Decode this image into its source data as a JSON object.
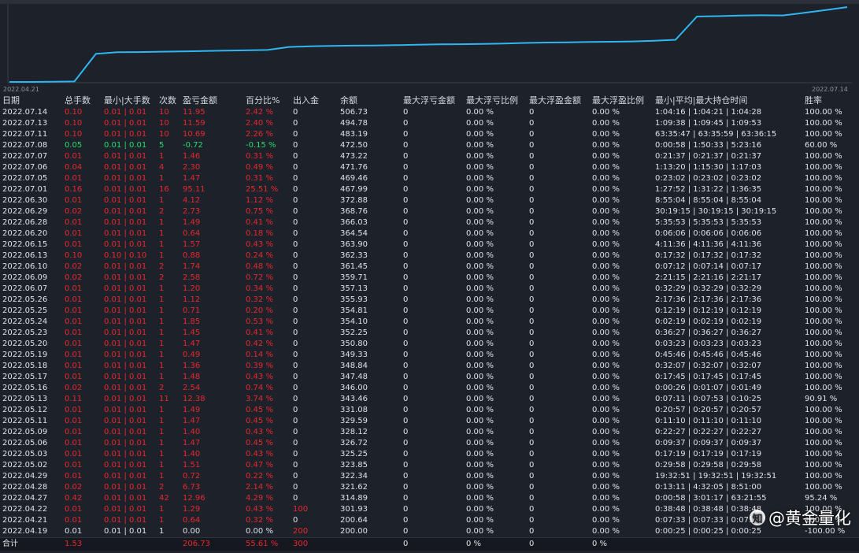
{
  "chart_data": {
    "type": "line",
    "x_start_label": "2022.04.21",
    "x_end_label": "2022.07.14",
    "line_color": "#2fb6f0",
    "series": [
      {
        "values": [
          200.0,
          200.64,
          201.93,
          314.89,
          321.62,
          322.34,
          323.85,
          325.25,
          326.72,
          328.12,
          329.59,
          331.08,
          343.46,
          346.0,
          347.48,
          348.84,
          349.33,
          350.8,
          352.25,
          354.1,
          354.81,
          355.93,
          357.13,
          359.71,
          361.45,
          362.33,
          363.9,
          364.54,
          366.03,
          368.76,
          372.88,
          467.99,
          469.46,
          471.76,
          473.22,
          472.5,
          483.19,
          494.78,
          506.73
        ]
      }
    ]
  },
  "table": {
    "headers": [
      "日期",
      "总手数",
      "最小|大手数",
      "次数",
      "盈亏金额",
      "百分比%",
      "出入金",
      "余额",
      "最大浮亏金额",
      "最大浮亏比例",
      "最大浮盈金额",
      "最大浮盈比例",
      "最小|平均|最大持仓时间",
      "胜率"
    ],
    "rows": [
      {
        "date": "2022.07.14",
        "lots": "0.10",
        "minmax": "0.01 | 0.01",
        "count": "10",
        "pnl": "11.95",
        "pct": "2.42 %",
        "flow": "0",
        "balance": "506.73",
        "fl_amt": "0",
        "fl_pct": "0.00 %",
        "fp_amt": "0",
        "fp_pct": "0.00 %",
        "hold": "1:04:16 | 1:04:21 | 1:04:28",
        "win": "100.00 %",
        "color": "red"
      },
      {
        "date": "2022.07.13",
        "lots": "0.10",
        "minmax": "0.01 | 0.01",
        "count": "10",
        "pnl": "11.59",
        "pct": "2.40 %",
        "flow": "0",
        "balance": "494.78",
        "fl_amt": "0",
        "fl_pct": "0.00 %",
        "fp_amt": "0",
        "fp_pct": "0.00 %",
        "hold": "1:09:38 | 1:09:45 | 1:09:53",
        "win": "100.00 %",
        "color": "red"
      },
      {
        "date": "2022.07.11",
        "lots": "0.10",
        "minmax": "0.01 | 0.01",
        "count": "10",
        "pnl": "10.69",
        "pct": "2.26 %",
        "flow": "0",
        "balance": "483.19",
        "fl_amt": "0",
        "fl_pct": "0.00 %",
        "fp_amt": "0",
        "fp_pct": "0.00 %",
        "hold": "63:35:47 | 63:35:59 | 63:36:15",
        "win": "100.00 %",
        "color": "red"
      },
      {
        "date": "2022.07.08",
        "lots": "0.05",
        "minmax": "0.01 | 0.01",
        "count": "5",
        "pnl": "-0.72",
        "pct": "-0.15 %",
        "flow": "0",
        "balance": "472.50",
        "fl_amt": "0",
        "fl_pct": "0.00 %",
        "fp_amt": "0",
        "fp_pct": "0.00 %",
        "hold": "0:00:58 | 1:50:33 | 5:23:16",
        "win": "60.00 %",
        "color": "green"
      },
      {
        "date": "2022.07.07",
        "lots": "0.01",
        "minmax": "0.01 | 0.01",
        "count": "1",
        "pnl": "1.46",
        "pct": "0.31 %",
        "flow": "0",
        "balance": "473.22",
        "fl_amt": "0",
        "fl_pct": "0.00 %",
        "fp_amt": "0",
        "fp_pct": "0.00 %",
        "hold": "0:21:37 | 0:21:37 | 0:21:37",
        "win": "100.00 %",
        "color": "red"
      },
      {
        "date": "2022.07.06",
        "lots": "0.04",
        "minmax": "0.01 | 0.01",
        "count": "4",
        "pnl": "2.30",
        "pct": "0.49 %",
        "flow": "0",
        "balance": "471.76",
        "fl_amt": "0",
        "fl_pct": "0.00 %",
        "fp_amt": "0",
        "fp_pct": "0.00 %",
        "hold": "1:13:20 | 1:15:30 | 1:17:03",
        "win": "100.00 %",
        "color": "red"
      },
      {
        "date": "2022.07.05",
        "lots": "0.01",
        "minmax": "0.01 | 0.01",
        "count": "1",
        "pnl": "1.47",
        "pct": "0.31 %",
        "flow": "0",
        "balance": "469.46",
        "fl_amt": "0",
        "fl_pct": "0.00 %",
        "fp_amt": "0",
        "fp_pct": "0.00 %",
        "hold": "0:23:02 | 0:23:02 | 0:23:02",
        "win": "100.00 %",
        "color": "red"
      },
      {
        "date": "2022.07.01",
        "lots": "0.16",
        "minmax": "0.01 | 0.01",
        "count": "16",
        "pnl": "95.11",
        "pct": "25.51 %",
        "flow": "0",
        "balance": "467.99",
        "fl_amt": "0",
        "fl_pct": "0.00 %",
        "fp_amt": "0",
        "fp_pct": "0.00 %",
        "hold": "1:27:52 | 1:31:22 | 1:36:35",
        "win": "100.00 %",
        "color": "red"
      },
      {
        "date": "2022.06.30",
        "lots": "0.01",
        "minmax": "0.01 | 0.01",
        "count": "1",
        "pnl": "4.12",
        "pct": "1.12 %",
        "flow": "0",
        "balance": "372.88",
        "fl_amt": "0",
        "fl_pct": "0.00 %",
        "fp_amt": "0",
        "fp_pct": "0.00 %",
        "hold": "8:55:04 | 8:55:04 | 8:55:04",
        "win": "100.00 %",
        "color": "red"
      },
      {
        "date": "2022.06.29",
        "lots": "0.02",
        "minmax": "0.01 | 0.01",
        "count": "2",
        "pnl": "2.73",
        "pct": "0.75 %",
        "flow": "0",
        "balance": "368.76",
        "fl_amt": "0",
        "fl_pct": "0.00 %",
        "fp_amt": "0",
        "fp_pct": "0.00 %",
        "hold": "30:19:15 | 30:19:15 | 30:19:15",
        "win": "100.00 %",
        "color": "red"
      },
      {
        "date": "2022.06.28",
        "lots": "0.01",
        "minmax": "0.01 | 0.01",
        "count": "1",
        "pnl": "1.49",
        "pct": "0.41 %",
        "flow": "0",
        "balance": "366.03",
        "fl_amt": "0",
        "fl_pct": "0.00 %",
        "fp_amt": "0",
        "fp_pct": "0.00 %",
        "hold": "5:35:53 | 5:35:53 | 5:35:53",
        "win": "100.00 %",
        "color": "red"
      },
      {
        "date": "2022.06.20",
        "lots": "0.01",
        "minmax": "0.01 | 0.01",
        "count": "1",
        "pnl": "0.64",
        "pct": "0.18 %",
        "flow": "0",
        "balance": "364.54",
        "fl_amt": "0",
        "fl_pct": "0.00 %",
        "fp_amt": "0",
        "fp_pct": "0.00 %",
        "hold": "0:06:06 | 0:06:06 | 0:06:06",
        "win": "100.00 %",
        "color": "red"
      },
      {
        "date": "2022.06.15",
        "lots": "0.01",
        "minmax": "0.01 | 0.01",
        "count": "1",
        "pnl": "1.57",
        "pct": "0.43 %",
        "flow": "0",
        "balance": "363.90",
        "fl_amt": "0",
        "fl_pct": "0.00 %",
        "fp_amt": "0",
        "fp_pct": "0.00 %",
        "hold": "4:11:36 | 4:11:36 | 4:11:36",
        "win": "100.00 %",
        "color": "red"
      },
      {
        "date": "2022.06.13",
        "lots": "0.10",
        "minmax": "0.10 | 0.10",
        "count": "1",
        "pnl": "0.88",
        "pct": "0.24 %",
        "flow": "0",
        "balance": "362.33",
        "fl_amt": "0",
        "fl_pct": "0.00 %",
        "fp_amt": "0",
        "fp_pct": "0.00 %",
        "hold": "0:17:32 | 0:17:32 | 0:17:32",
        "win": "100.00 %",
        "color": "red"
      },
      {
        "date": "2022.06.10",
        "lots": "0.02",
        "minmax": "0.01 | 0.01",
        "count": "2",
        "pnl": "1.74",
        "pct": "0.48 %",
        "flow": "0",
        "balance": "361.45",
        "fl_amt": "0",
        "fl_pct": "0.00 %",
        "fp_amt": "0",
        "fp_pct": "0.00 %",
        "hold": "0:07:12 | 0:07:14 | 0:07:17",
        "win": "100.00 %",
        "color": "red"
      },
      {
        "date": "2022.06.09",
        "lots": "0.02",
        "minmax": "0.01 | 0.01",
        "count": "2",
        "pnl": "2.58",
        "pct": "0.72 %",
        "flow": "0",
        "balance": "359.71",
        "fl_amt": "0",
        "fl_pct": "0.00 %",
        "fp_amt": "0",
        "fp_pct": "0.00 %",
        "hold": "2:21:15 | 2:21:16 | 2:21:17",
        "win": "100.00 %",
        "color": "red"
      },
      {
        "date": "2022.06.07",
        "lots": "0.01",
        "minmax": "0.01 | 0.01",
        "count": "1",
        "pnl": "1.20",
        "pct": "0.34 %",
        "flow": "0",
        "balance": "357.13",
        "fl_amt": "0",
        "fl_pct": "0.00 %",
        "fp_amt": "0",
        "fp_pct": "0.00 %",
        "hold": "0:32:29 | 0:32:29 | 0:32:29",
        "win": "100.00 %",
        "color": "red"
      },
      {
        "date": "2022.05.26",
        "lots": "0.01",
        "minmax": "0.01 | 0.01",
        "count": "1",
        "pnl": "1.12",
        "pct": "0.32 %",
        "flow": "0",
        "balance": "355.93",
        "fl_amt": "0",
        "fl_pct": "0.00 %",
        "fp_amt": "0",
        "fp_pct": "0.00 %",
        "hold": "2:17:36 | 2:17:36 | 2:17:36",
        "win": "100.00 %",
        "color": "red"
      },
      {
        "date": "2022.05.25",
        "lots": "0.01",
        "minmax": "0.01 | 0.01",
        "count": "1",
        "pnl": "0.71",
        "pct": "0.20 %",
        "flow": "0",
        "balance": "354.81",
        "fl_amt": "0",
        "fl_pct": "0.00 %",
        "fp_amt": "0",
        "fp_pct": "0.00 %",
        "hold": "0:12:19 | 0:12:19 | 0:12:19",
        "win": "100.00 %",
        "color": "red"
      },
      {
        "date": "2022.05.24",
        "lots": "0.01",
        "minmax": "0.01 | 0.01",
        "count": "1",
        "pnl": "1.85",
        "pct": "0.53 %",
        "flow": "0",
        "balance": "354.10",
        "fl_amt": "0",
        "fl_pct": "0.00 %",
        "fp_amt": "0",
        "fp_pct": "0.00 %",
        "hold": "0:02:19 | 0:02:19 | 0:02:19",
        "win": "100.00 %",
        "color": "red"
      },
      {
        "date": "2022.05.23",
        "lots": "0.01",
        "minmax": "0.01 | 0.01",
        "count": "1",
        "pnl": "1.45",
        "pct": "0.41 %",
        "flow": "0",
        "balance": "352.25",
        "fl_amt": "0",
        "fl_pct": "0.00 %",
        "fp_amt": "0",
        "fp_pct": "0.00 %",
        "hold": "0:36:27 | 0:36:27 | 0:36:27",
        "win": "100.00 %",
        "color": "red"
      },
      {
        "date": "2022.05.20",
        "lots": "0.01",
        "minmax": "0.01 | 0.01",
        "count": "1",
        "pnl": "1.47",
        "pct": "0.42 %",
        "flow": "0",
        "balance": "350.80",
        "fl_amt": "0",
        "fl_pct": "0.00 %",
        "fp_amt": "0",
        "fp_pct": "0.00 %",
        "hold": "0:03:23 | 0:03:23 | 0:03:23",
        "win": "100.00 %",
        "color": "red"
      },
      {
        "date": "2022.05.19",
        "lots": "0.01",
        "minmax": "0.01 | 0.01",
        "count": "1",
        "pnl": "0.49",
        "pct": "0.14 %",
        "flow": "0",
        "balance": "349.33",
        "fl_amt": "0",
        "fl_pct": "0.00 %",
        "fp_amt": "0",
        "fp_pct": "0.00 %",
        "hold": "0:45:46 | 0:45:46 | 0:45:46",
        "win": "100.00 %",
        "color": "red"
      },
      {
        "date": "2022.05.18",
        "lots": "0.01",
        "minmax": "0.01 | 0.01",
        "count": "1",
        "pnl": "1.36",
        "pct": "0.39 %",
        "flow": "0",
        "balance": "348.84",
        "fl_amt": "0",
        "fl_pct": "0.00 %",
        "fp_amt": "0",
        "fp_pct": "0.00 %",
        "hold": "0:32:07 | 0:32:07 | 0:32:07",
        "win": "100.00 %",
        "color": "red"
      },
      {
        "date": "2022.05.17",
        "lots": "0.01",
        "minmax": "0.01 | 0.01",
        "count": "1",
        "pnl": "1.48",
        "pct": "0.43 %",
        "flow": "0",
        "balance": "347.48",
        "fl_amt": "0",
        "fl_pct": "0.00 %",
        "fp_amt": "0",
        "fp_pct": "0.00 %",
        "hold": "0:17:45 | 0:17:45 | 0:17:45",
        "win": "100.00 %",
        "color": "red"
      },
      {
        "date": "2022.05.16",
        "lots": "0.02",
        "minmax": "0.01 | 0.01",
        "count": "2",
        "pnl": "2.54",
        "pct": "0.74 %",
        "flow": "0",
        "balance": "346.00",
        "fl_amt": "0",
        "fl_pct": "0.00 %",
        "fp_amt": "0",
        "fp_pct": "0.00 %",
        "hold": "0:00:26 | 0:01:07 | 0:01:49",
        "win": "100.00 %",
        "color": "red"
      },
      {
        "date": "2022.05.13",
        "lots": "0.11",
        "minmax": "0.01 | 0.01",
        "count": "11",
        "pnl": "12.38",
        "pct": "3.74 %",
        "flow": "0",
        "balance": "343.46",
        "fl_amt": "0",
        "fl_pct": "0.00 %",
        "fp_amt": "0",
        "fp_pct": "0.00 %",
        "hold": "0:07:11 | 0:07:53 | 0:10:25",
        "win": "90.91 %",
        "color": "red"
      },
      {
        "date": "2022.05.12",
        "lots": "0.01",
        "minmax": "0.01 | 0.01",
        "count": "1",
        "pnl": "1.49",
        "pct": "0.45 %",
        "flow": "0",
        "balance": "331.08",
        "fl_amt": "0",
        "fl_pct": "0.00 %",
        "fp_amt": "0",
        "fp_pct": "0.00 %",
        "hold": "0:20:57 | 0:20:57 | 0:20:57",
        "win": "100.00 %",
        "color": "red"
      },
      {
        "date": "2022.05.11",
        "lots": "0.01",
        "minmax": "0.01 | 0.01",
        "count": "1",
        "pnl": "1.47",
        "pct": "0.45 %",
        "flow": "0",
        "balance": "329.59",
        "fl_amt": "0",
        "fl_pct": "0.00 %",
        "fp_amt": "0",
        "fp_pct": "0.00 %",
        "hold": "0:11:10 | 0:11:10 | 0:11:10",
        "win": "100.00 %",
        "color": "red"
      },
      {
        "date": "2022.05.09",
        "lots": "0.01",
        "minmax": "0.01 | 0.01",
        "count": "1",
        "pnl": "1.40",
        "pct": "0.43 %",
        "flow": "0",
        "balance": "328.12",
        "fl_amt": "0",
        "fl_pct": "0.00 %",
        "fp_amt": "0",
        "fp_pct": "0.00 %",
        "hold": "0:22:27 | 0:22:27 | 0:22:27",
        "win": "100.00 %",
        "color": "red"
      },
      {
        "date": "2022.05.06",
        "lots": "0.01",
        "minmax": "0.01 | 0.01",
        "count": "1",
        "pnl": "1.47",
        "pct": "0.45 %",
        "flow": "0",
        "balance": "326.72",
        "fl_amt": "0",
        "fl_pct": "0.00 %",
        "fp_amt": "0",
        "fp_pct": "0.00 %",
        "hold": "0:09:37 | 0:09:37 | 0:09:37",
        "win": "100.00 %",
        "color": "red"
      },
      {
        "date": "2022.05.03",
        "lots": "0.01",
        "minmax": "0.01 | 0.01",
        "count": "1",
        "pnl": "1.40",
        "pct": "0.43 %",
        "flow": "0",
        "balance": "325.25",
        "fl_amt": "0",
        "fl_pct": "0.00 %",
        "fp_amt": "0",
        "fp_pct": "0.00 %",
        "hold": "0:17:19 | 0:17:19 | 0:17:19",
        "win": "100.00 %",
        "color": "red"
      },
      {
        "date": "2022.05.02",
        "lots": "0.01",
        "minmax": "0.01 | 0.01",
        "count": "1",
        "pnl": "1.51",
        "pct": "0.47 %",
        "flow": "0",
        "balance": "323.85",
        "fl_amt": "0",
        "fl_pct": "0.00 %",
        "fp_amt": "0",
        "fp_pct": "0.00 %",
        "hold": "0:29:58 | 0:29:58 | 0:29:58",
        "win": "100.00 %",
        "color": "red"
      },
      {
        "date": "2022.04.29",
        "lots": "0.01",
        "minmax": "0.01 | 0.01",
        "count": "1",
        "pnl": "0.72",
        "pct": "0.22 %",
        "flow": "0",
        "balance": "322.34",
        "fl_amt": "0",
        "fl_pct": "0.00 %",
        "fp_amt": "0",
        "fp_pct": "0.00 %",
        "hold": "19:32:51 | 19:32:51 | 19:32:51",
        "win": "100.00 %",
        "color": "red"
      },
      {
        "date": "2022.04.28",
        "lots": "0.02",
        "minmax": "0.01 | 0.01",
        "count": "2",
        "pnl": "6.73",
        "pct": "2.14 %",
        "flow": "0",
        "balance": "321.62",
        "fl_amt": "0",
        "fl_pct": "0.00 %",
        "fp_amt": "0",
        "fp_pct": "0.00 %",
        "hold": "0:13:11 | 4:32:05 | 8:51:00",
        "win": "100.00 %",
        "color": "red"
      },
      {
        "date": "2022.04.27",
        "lots": "0.42",
        "minmax": "0.01 | 0.01",
        "count": "42",
        "pnl": "12.96",
        "pct": "4.29 %",
        "flow": "0",
        "balance": "314.89",
        "fl_amt": "0",
        "fl_pct": "0.00 %",
        "fp_amt": "0",
        "fp_pct": "0.00 %",
        "hold": "0:00:58 | 3:01:17 | 63:21:55",
        "win": "95.24 %",
        "color": "red"
      },
      {
        "date": "2022.04.22",
        "lots": "0.01",
        "minmax": "0.01 | 0.01",
        "count": "1",
        "pnl": "1.29",
        "pct": "0.43 %",
        "flow": "100",
        "balance": "301.93",
        "fl_amt": "0",
        "fl_pct": "0.00 %",
        "fp_amt": "0",
        "fp_pct": "0.00 %",
        "hold": "0:38:48 | 0:38:48 | 0:38:48",
        "win": "100.00 %",
        "color": "red",
        "flow_color": "red"
      },
      {
        "date": "2022.04.21",
        "lots": "0.01",
        "minmax": "0.01 | 0.01",
        "count": "1",
        "pnl": "0.64",
        "pct": "0.32 %",
        "flow": "0",
        "balance": "200.64",
        "fl_amt": "0",
        "fl_pct": "0.00 %",
        "fp_amt": "0",
        "fp_pct": "0.00 %",
        "hold": "0:07:33 | 0:07:33 | 0:07:33",
        "win": "100.00 %",
        "color": "red"
      },
      {
        "date": "2022.04.19",
        "lots": "0.01",
        "minmax": "0.01 | 0.01",
        "count": "1",
        "pnl": "0.00",
        "pct": "0.00 %",
        "flow": "200",
        "balance": "200.00",
        "fl_amt": "0",
        "fl_pct": "0.00 %",
        "fp_amt": "0",
        "fp_pct": "0.00 %",
        "hold": "0:00:25 | 0:00:25 | 0:00:25",
        "win": "-100.00 %",
        "color": "white",
        "flow_color": "red"
      }
    ],
    "total": {
      "label": "合计",
      "lots": "1.53",
      "pnl": "206.73",
      "pct": "55.61 %",
      "flow": "300",
      "fl_amt": "0",
      "fl_pct": "0 %",
      "fp_amt": "0",
      "fp_pct": "0 %"
    }
  },
  "watermark": {
    "text": "@黄金量化",
    "icon": "zhihu-icon"
  }
}
